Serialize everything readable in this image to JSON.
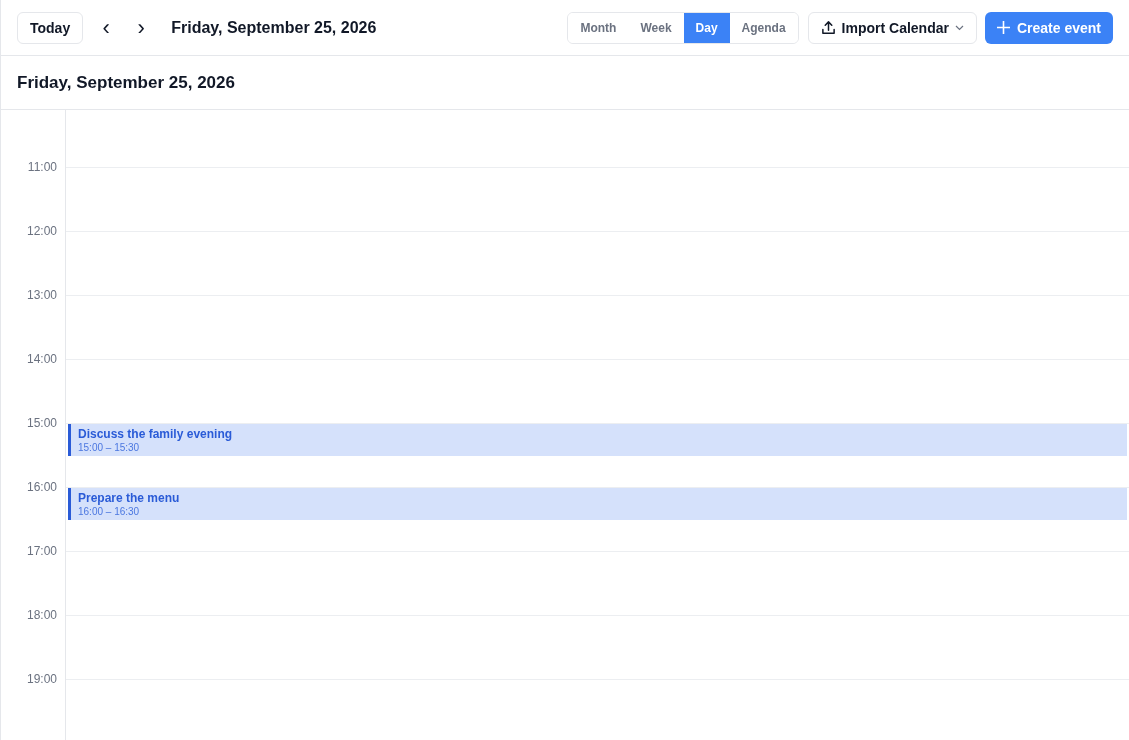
{
  "toolbar": {
    "today": "Today",
    "prev": "‹",
    "next": "›",
    "title": "Friday, September 25, 2026"
  },
  "views": [
    {
      "label": "Month",
      "selected": false
    },
    {
      "label": "Week",
      "selected": false
    },
    {
      "label": "Day",
      "selected": true
    },
    {
      "label": "Agenda",
      "selected": false
    }
  ],
  "import_button": {
    "label": "Import Calendar"
  },
  "create_button": {
    "label": "Create event"
  },
  "day_header": "Friday, September 25, 2026",
  "hours": [
    {
      "label": "11:00"
    },
    {
      "label": "12:00"
    },
    {
      "label": "13:00"
    },
    {
      "label": "14:00"
    },
    {
      "label": "15:00",
      "events": [
        {
          "title": "Discuss the family evening",
          "time": "15:00 – 15:30"
        }
      ]
    },
    {
      "label": "16:00",
      "events": [
        {
          "title": "Prepare the menu",
          "time": "16:00 – 16:30"
        }
      ]
    },
    {
      "label": "17:00"
    },
    {
      "label": "18:00"
    },
    {
      "label": "19:00"
    }
  ]
}
